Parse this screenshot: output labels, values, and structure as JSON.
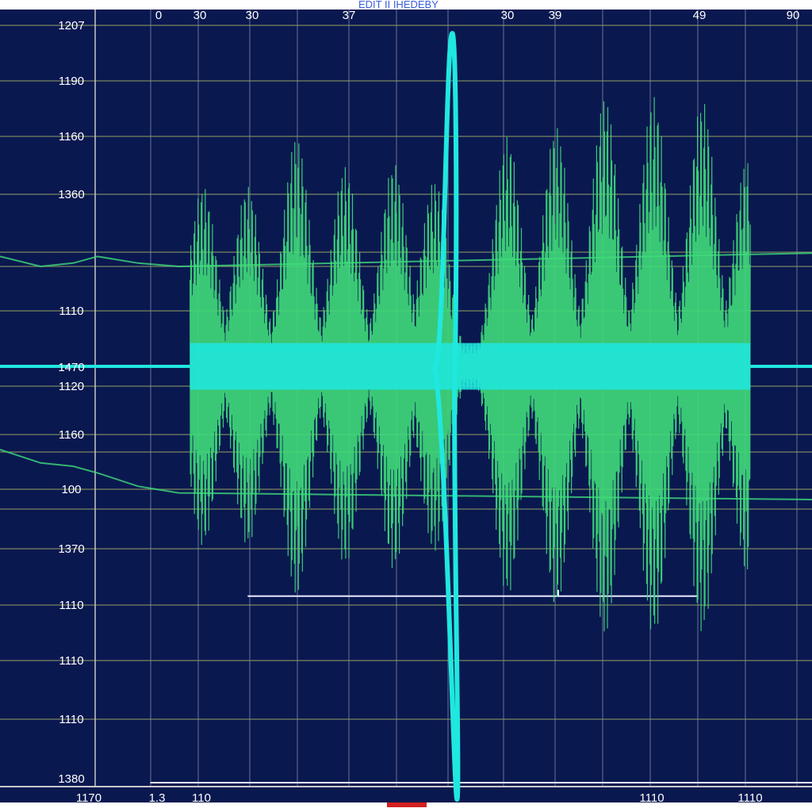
{
  "title": "EDIT   II  IHEDEBY",
  "colors": {
    "background": "#0a1850",
    "grid": "#8e9a62",
    "grid_vertical": "#8a93a8",
    "trace": "#1fe8e0",
    "trace_secondary": "#3fdc7a",
    "marker": "#e8e8ff",
    "indicator": "#d42020"
  },
  "chart_data": {
    "type": "line",
    "title": "EDIT   II  IHEDEBY",
    "xlabel": "",
    "ylabel": "",
    "grid": true,
    "x_tick_labels_top": [
      "0",
      "30",
      "30",
      "37",
      "",
      "",
      "30",
      "39",
      "",
      "",
      "49",
      "90"
    ],
    "x_tick_labels_bottom": [
      "1170",
      "1.3",
      "110",
      "1110",
      "1110"
    ],
    "y_tick_labels": [
      "1207",
      "1190",
      "1160",
      "1360",
      "1110",
      "1470",
      "1120",
      "1160",
      "100",
      "1370",
      "1110",
      "1110",
      "1110",
      "1380"
    ],
    "xlim": [
      0,
      100
    ],
    "ylim": [
      -1,
      1
    ],
    "burst": {
      "x_start": 23.4,
      "x_end": 92.4,
      "lobe_centers": [
        25,
        30.5,
        36.5,
        42.5,
        48.5,
        53.5,
        62.5,
        68.5,
        74.5,
        80.5,
        86.5,
        92
      ],
      "lobe_peaks": [
        0.54,
        0.54,
        0.69,
        0.6,
        0.61,
        0.56,
        0.69,
        0.72,
        0.81,
        0.81,
        0.8,
        0.62
      ],
      "band_amplitude": 0.07
    },
    "spike": {
      "x": 55.7,
      "max": 1.0,
      "min": -1.3
    },
    "baseline_level": 0.0,
    "side_traces": [
      {
        "x": [
          0,
          5,
          9,
          12,
          17,
          22,
          100
        ],
        "y": [
          0.33,
          0.3,
          0.31,
          0.33,
          0.31,
          0.3,
          0.34
        ]
      },
      {
        "x": [
          0,
          5,
          9,
          12,
          17,
          22,
          100
        ],
        "y": [
          -0.25,
          -0.29,
          -0.3,
          -0.32,
          -0.36,
          -0.38,
          -0.4
        ]
      }
    ],
    "markers": [
      {
        "x_start": 30.5,
        "x_end": 86,
        "y": -0.69
      },
      {
        "x_start": 18.5,
        "x_end": 100,
        "y": -1.25
      }
    ]
  }
}
